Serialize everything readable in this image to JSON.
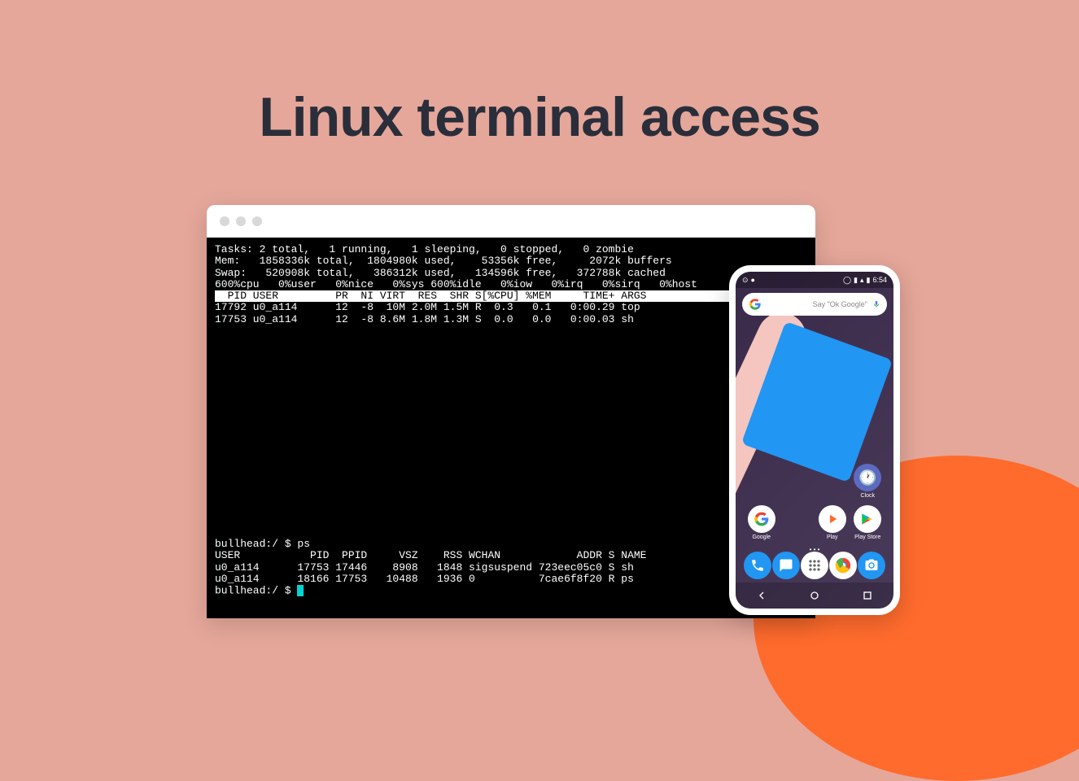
{
  "heading": "Linux terminal access",
  "terminal": {
    "lines": {
      "l1": "Tasks: 2 total,   1 running,   1 sleeping,   0 stopped,   0 zombie",
      "l2": "Mem:   1858336k total,  1804980k used,    53356k free,     2072k buffers",
      "l3": "Swap:   520908k total,   386312k used,   134596k free,   372788k cached",
      "l4": "600%cpu   0%user   0%nice   0%sys 600%idle   0%iow   0%irq   0%sirq   0%host",
      "header": "  PID USER         PR  NI VIRT  RES  SHR S[%CPU] %MEM     TIME+ ARGS       ",
      "p1": "17792 u0_a114      12  -8  10M 2.0M 1.5M R  0.3   0.1   0:00.29 top",
      "p2": "17753 u0_a114      12  -8 8.6M 1.8M 1.3M S  0.0   0.0   0:00.03 sh",
      "prompt1": "bullhead:/ $ ps",
      "ps_header": "USER           PID  PPID     VSZ    RSS WCHAN            ADDR S NAME",
      "ps1": "u0_a114      17753 17446    8908   1848 sigsuspend 723eec05c0 S sh",
      "ps2": "u0_a114      18166 17753   10488   1936 0          7cae6f8f20 R ps",
      "prompt2": "bullhead:/ $ "
    }
  },
  "phone": {
    "status_time": "6:54",
    "search_placeholder": "Say \"Ok Google\"",
    "apps": {
      "clock": "Clock",
      "google": "Google",
      "play": "Play",
      "playstore": "Play Store"
    }
  }
}
